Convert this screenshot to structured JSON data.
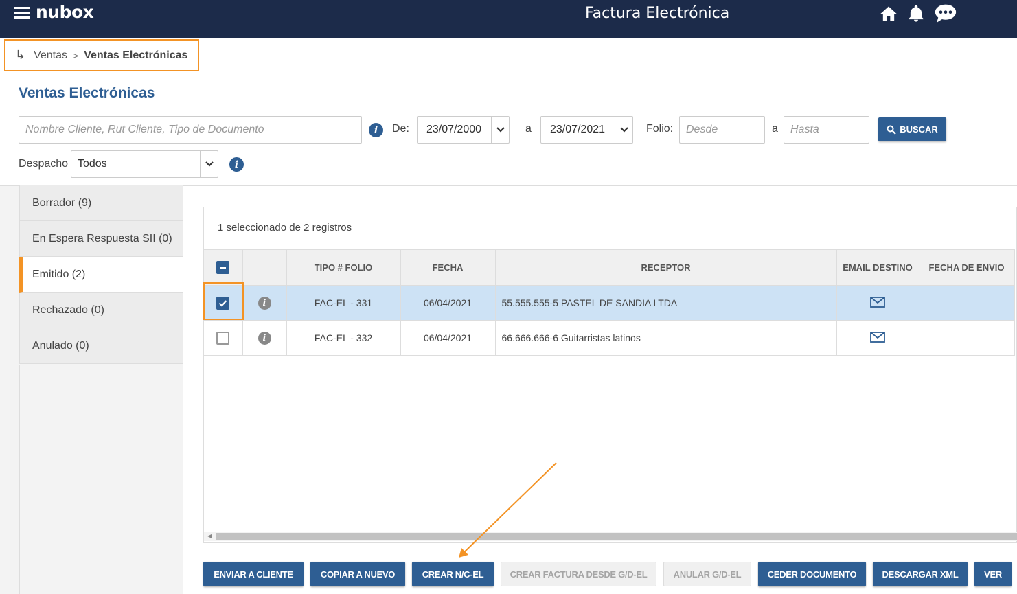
{
  "header": {
    "brand": "nubox",
    "title": "Factura Electrónica"
  },
  "breadcrumb": {
    "parent": "Ventas",
    "separator": ">",
    "current": "Ventas Electrónicas"
  },
  "page_title": "Ventas Electrónicas",
  "filters": {
    "search_placeholder": "Nombre Cliente, Rut Cliente, Tipo de Documento",
    "de_label": "De:",
    "date_from": "23/07/2000",
    "a_label": "a",
    "date_to": "23/07/2021",
    "folio_label": "Folio:",
    "folio_from_placeholder": "Desde",
    "folio_to_placeholder": "Hasta",
    "buscar_label": "BUSCAR",
    "despacho_label": "Despacho",
    "despacho_value": "Todos"
  },
  "sidebar": {
    "items": [
      {
        "label": "Borrador (9)"
      },
      {
        "label": "En Espera Respuesta SII (0)"
      },
      {
        "label": "Emitido (2)"
      },
      {
        "label": "Rechazado (0)"
      },
      {
        "label": "Anulado (0)"
      }
    ]
  },
  "table": {
    "count_text": "1 seleccionado de 2 registros",
    "headers": [
      "TIPO # FOLIO",
      "FECHA",
      "RECEPTOR",
      "EMAIL DESTINO",
      "FECHA DE ENVIO"
    ],
    "rows": [
      {
        "folio": "FAC-EL - 331",
        "fecha": "06/04/2021",
        "receptor": "55.555.555-5 PASTEL DE SANDIA LTDA",
        "selected": true
      },
      {
        "folio": "FAC-EL - 332",
        "fecha": "06/04/2021",
        "receptor": "66.666.666-6 Guitarristas latinos",
        "selected": false
      }
    ]
  },
  "actions": {
    "enviar": "ENVIAR A CLIENTE",
    "copiar": "COPIAR A NUEVO",
    "crear_nc": "CREAR N/C-EL",
    "crear_factura": "CREAR FACTURA DESDE G/D-EL",
    "anular": "ANULAR G/D-EL",
    "ceder": "CEDER DOCUMENTO",
    "descargar": "DESCARGAR XML",
    "ver": "VER"
  },
  "colors": {
    "topbar": "#1c2b4a",
    "primary": "#2e5e93",
    "highlight": "#f39325",
    "selected_row": "#cde2f5"
  }
}
